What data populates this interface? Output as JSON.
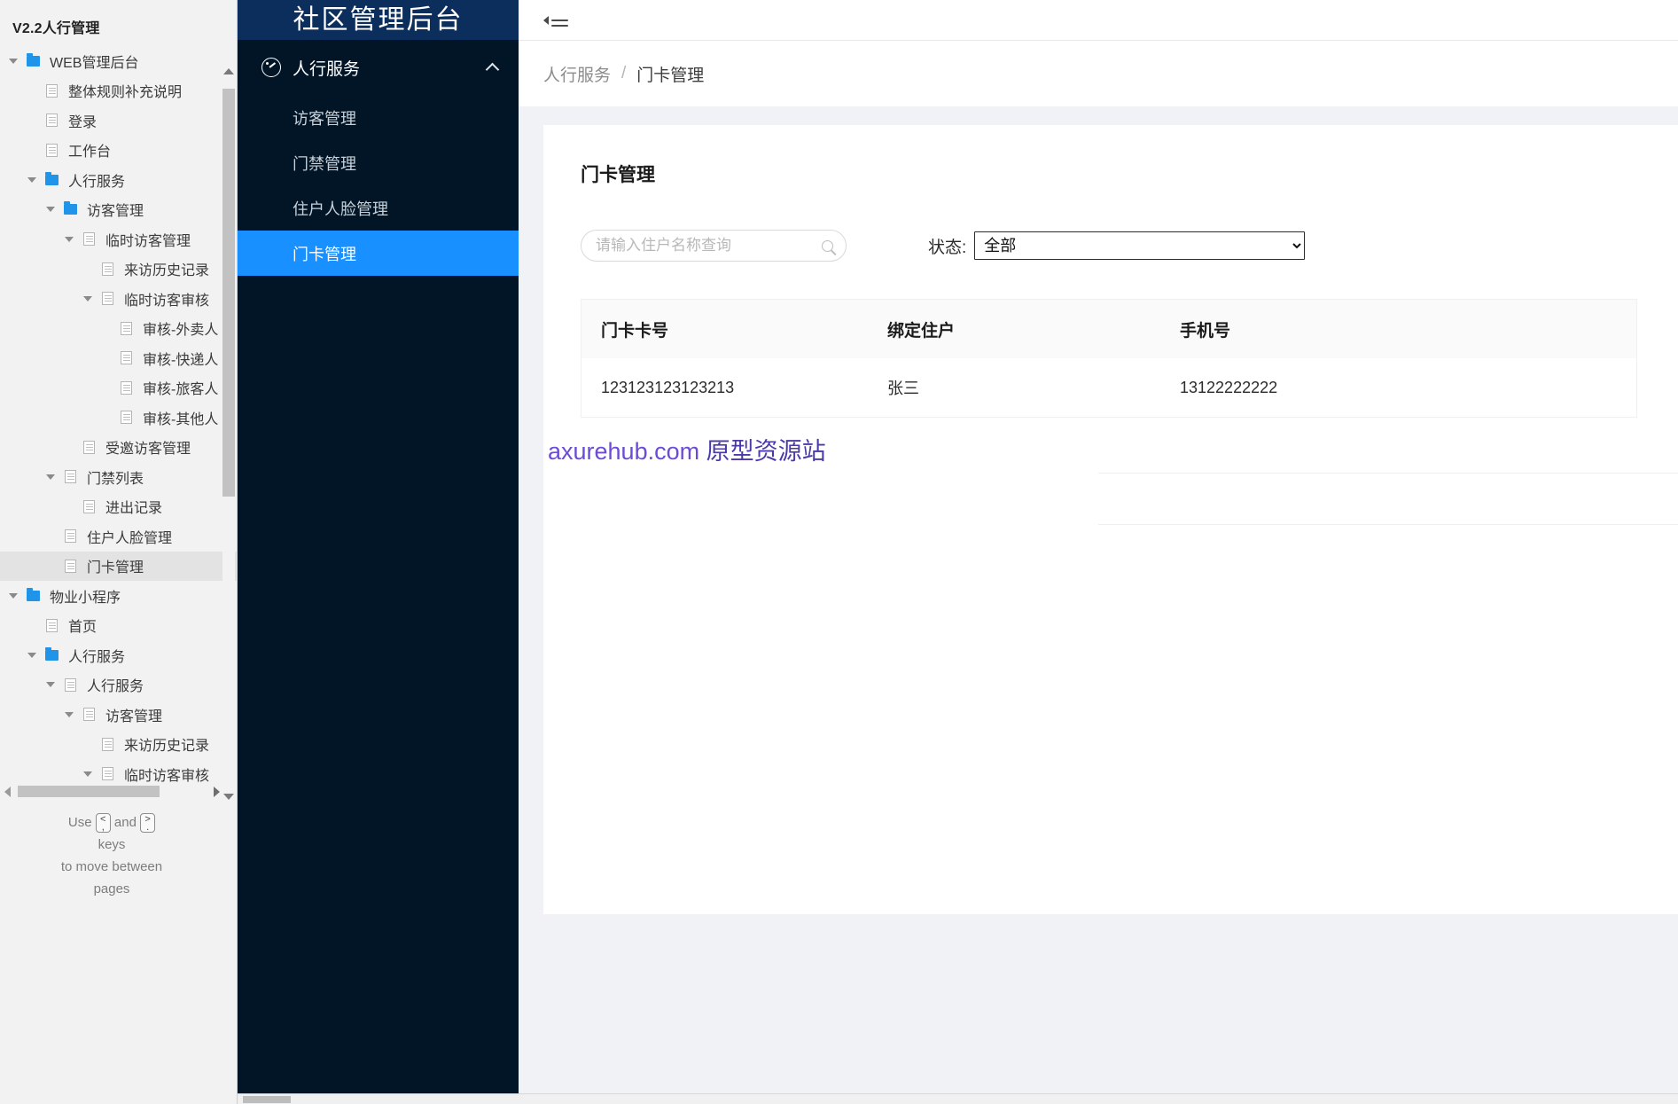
{
  "sitemap": {
    "title": "V2.2人行管理",
    "nodes": [
      {
        "label": "WEB管理后台",
        "indent": 0,
        "icon": "folder",
        "caret": true,
        "selected": false
      },
      {
        "label": "整体规则补充说明",
        "indent": 1,
        "icon": "page",
        "caret": false,
        "selected": false
      },
      {
        "label": "登录",
        "indent": 1,
        "icon": "page",
        "caret": false,
        "selected": false
      },
      {
        "label": "工作台",
        "indent": 1,
        "icon": "page",
        "caret": false,
        "selected": false
      },
      {
        "label": "人行服务",
        "indent": 1,
        "icon": "folder",
        "caret": true,
        "selected": false
      },
      {
        "label": "访客管理",
        "indent": 2,
        "icon": "folder",
        "caret": true,
        "selected": false
      },
      {
        "label": "临时访客管理",
        "indent": 3,
        "icon": "page",
        "caret": true,
        "selected": false
      },
      {
        "label": "来访历史记录",
        "indent": 4,
        "icon": "page",
        "caret": false,
        "selected": false
      },
      {
        "label": "临时访客审核",
        "indent": 4,
        "icon": "page",
        "caret": true,
        "selected": false
      },
      {
        "label": "审核-外卖人",
        "indent": 5,
        "icon": "page",
        "caret": false,
        "selected": false
      },
      {
        "label": "审核-快递人",
        "indent": 5,
        "icon": "page",
        "caret": false,
        "selected": false
      },
      {
        "label": "审核-旅客人",
        "indent": 5,
        "icon": "page",
        "caret": false,
        "selected": false
      },
      {
        "label": "审核-其他人",
        "indent": 5,
        "icon": "page",
        "caret": false,
        "selected": false
      },
      {
        "label": "受邀访客管理",
        "indent": 3,
        "icon": "page",
        "caret": false,
        "selected": false
      },
      {
        "label": "门禁列表",
        "indent": 2,
        "icon": "page",
        "caret": true,
        "selected": false
      },
      {
        "label": "进出记录",
        "indent": 3,
        "icon": "page",
        "caret": false,
        "selected": false
      },
      {
        "label": "住户人脸管理",
        "indent": 2,
        "icon": "page",
        "caret": false,
        "selected": false
      },
      {
        "label": "门卡管理",
        "indent": 2,
        "icon": "page",
        "caret": false,
        "selected": true
      },
      {
        "label": "物业小程序",
        "indent": 0,
        "icon": "folder",
        "caret": true,
        "selected": false
      },
      {
        "label": "首页",
        "indent": 1,
        "icon": "page",
        "caret": false,
        "selected": false
      },
      {
        "label": "人行服务",
        "indent": 1,
        "icon": "folder",
        "caret": true,
        "selected": false
      },
      {
        "label": "人行服务",
        "indent": 2,
        "icon": "page",
        "caret": true,
        "selected": false
      },
      {
        "label": "访客管理",
        "indent": 3,
        "icon": "page",
        "caret": true,
        "selected": false
      },
      {
        "label": "来访历史记录",
        "indent": 4,
        "icon": "page",
        "caret": false,
        "selected": false
      },
      {
        "label": "临时访客审核",
        "indent": 4,
        "icon": "page",
        "caret": true,
        "selected": false
      }
    ],
    "hint": {
      "use": "Use",
      "key_prev": "<",
      "key_prev_sub": ",",
      "and": "and",
      "key_next": ">",
      "key_next_sub": ".",
      "line2": "keys",
      "line3": "to move between",
      "line4": "pages"
    }
  },
  "appnav": {
    "brand": "社区管理后台",
    "group": {
      "label": "人行服务",
      "icon": "gauge-icon",
      "expand_icon": "chevron-up-icon"
    },
    "items": [
      {
        "label": "访客管理",
        "active": false
      },
      {
        "label": "门禁管理",
        "active": false
      },
      {
        "label": "住户人脸管理",
        "active": false
      },
      {
        "label": "门卡管理",
        "active": true
      }
    ],
    "accent": "#1890ff",
    "background": "#011527",
    "header_background": "#0b2e5c"
  },
  "topbar": {
    "collapse_icon": "menu-fold-icon"
  },
  "breadcrumb": {
    "root": "人行服务",
    "separator": "/",
    "current": "门卡管理"
  },
  "card": {
    "title": "门卡管理",
    "search": {
      "placeholder": "请输入住户名称查询",
      "value": "",
      "icon": "search-icon"
    },
    "status": {
      "label": "状态:",
      "selected": "全部",
      "options": [
        "全部"
      ]
    },
    "table": {
      "columns": [
        "门卡卡号",
        "绑定住户",
        "手机号"
      ],
      "rows": [
        {
          "card_no": "123123123123213",
          "resident": "张三",
          "phone": "13122222222"
        }
      ]
    }
  },
  "watermark": {
    "domain": "axurehub.com",
    "text": "原型资源站"
  }
}
